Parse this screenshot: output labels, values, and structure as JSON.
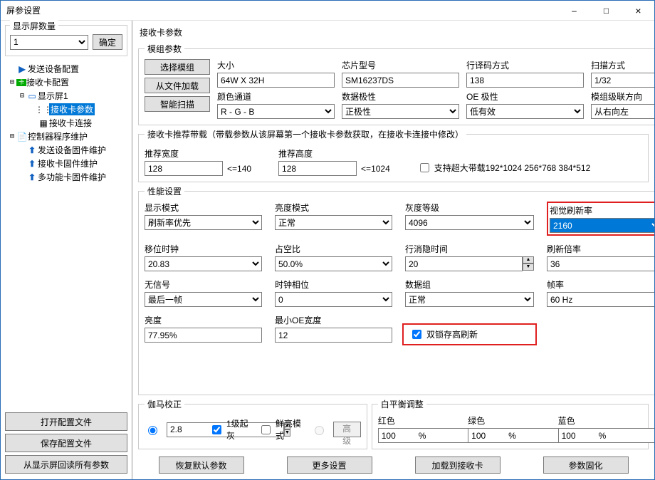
{
  "window": {
    "title": "屏参设置",
    "minimize": "–",
    "maximize": "□",
    "close": "×"
  },
  "left": {
    "count_label": "显示屏数量",
    "count_value": "1",
    "confirm": "确定",
    "tree": {
      "send_config": "发送设备配置",
      "recv_config": "接收卡配置",
      "screen1": "显示屏1",
      "recv_params": "接收卡参数",
      "recv_conn": "接收卡连接",
      "ctrl_maint": "控制器程序维护",
      "fw_send": "发送设备固件维护",
      "fw_recv": "接收卡固件维护",
      "fw_multi": "多功能卡固件维护"
    },
    "open_config": "打开配置文件",
    "save_config": "保存配置文件",
    "read_from_screen": "从显示屏回读所有参数"
  },
  "right": {
    "header": "接收卡参数",
    "module": {
      "legend": "模组参数",
      "size_l": "大小",
      "size_v": "64W X 32H",
      "chip_l": "芯片型号",
      "chip_v": "SM16237DS",
      "decode_l": "行译码方式",
      "decode_v": "138",
      "scan_l": "扫描方式",
      "scan_v": "1/32",
      "color_l": "颜色通道",
      "color_v": "R - G - B",
      "polar_l": "数据极性",
      "polar_v": "正极性",
      "oe_l": "OE 极性",
      "oe_v": "低有效",
      "cascade_l": "模组级联方向",
      "cascade_v": "从右向左",
      "btn_select": "选择模组",
      "btn_loadfile": "从文件加载",
      "btn_smartscan": "智能扫描"
    },
    "rec": {
      "legend": "接收卡推荐带载（带载参数从该屏幕第一个接收卡参数获取，在接收卡连接中修改）",
      "w_l": "推荐宽度",
      "w_v": "128",
      "w_hint": "<=140",
      "h_l": "推荐高度",
      "h_v": "128",
      "h_hint": "<=1024",
      "big_cb": "支持超大带载192*1024 256*768 384*512"
    },
    "perf": {
      "legend": "性能设置",
      "disp_mode_l": "显示模式",
      "disp_mode_v": "刷新率优先",
      "bright_mode_l": "亮度模式",
      "bright_mode_v": "正常",
      "gray_l": "灰度等级",
      "gray_v": "4096",
      "refresh_l": "视觉刷新率",
      "refresh_v": "2160",
      "shift_l": "移位时钟",
      "shift_v": "20.83",
      "duty_l": "占空比",
      "duty_v": "50.0%",
      "blank_l": "行消隐时间",
      "blank_v": "20",
      "mult_l": "刷新倍率",
      "mult_v": "36",
      "nosig_l": "无信号",
      "nosig_v": "最后一帧",
      "phase_l": "时钟相位",
      "phase_v": "0",
      "dg_l": "数据组",
      "dg_v": "正常",
      "fps_l": "帧率",
      "fps_v": "60 Hz",
      "bright_l": "亮度",
      "bright_v": "77.95%",
      "minoe_l": "最小OE宽度",
      "minoe_v": "12",
      "dbl_cb": "双锁存高刷新"
    },
    "gamma": {
      "legend": "伽马校正",
      "value": "2.8",
      "cb1": "1级起灰",
      "cb_fresh": "鲜亮模式",
      "adv": "高级"
    },
    "wb": {
      "legend": "白平衡调整",
      "r_l": "红色",
      "g_l": "绿色",
      "b_l": "蓝色",
      "r_v": "100",
      "g_v": "100",
      "b_v": "100",
      "pct": "%"
    },
    "footer": {
      "restore": "恢复默认参数",
      "more": "更多设置",
      "load_to": "加载到接收卡",
      "solidify": "参数固化"
    }
  }
}
